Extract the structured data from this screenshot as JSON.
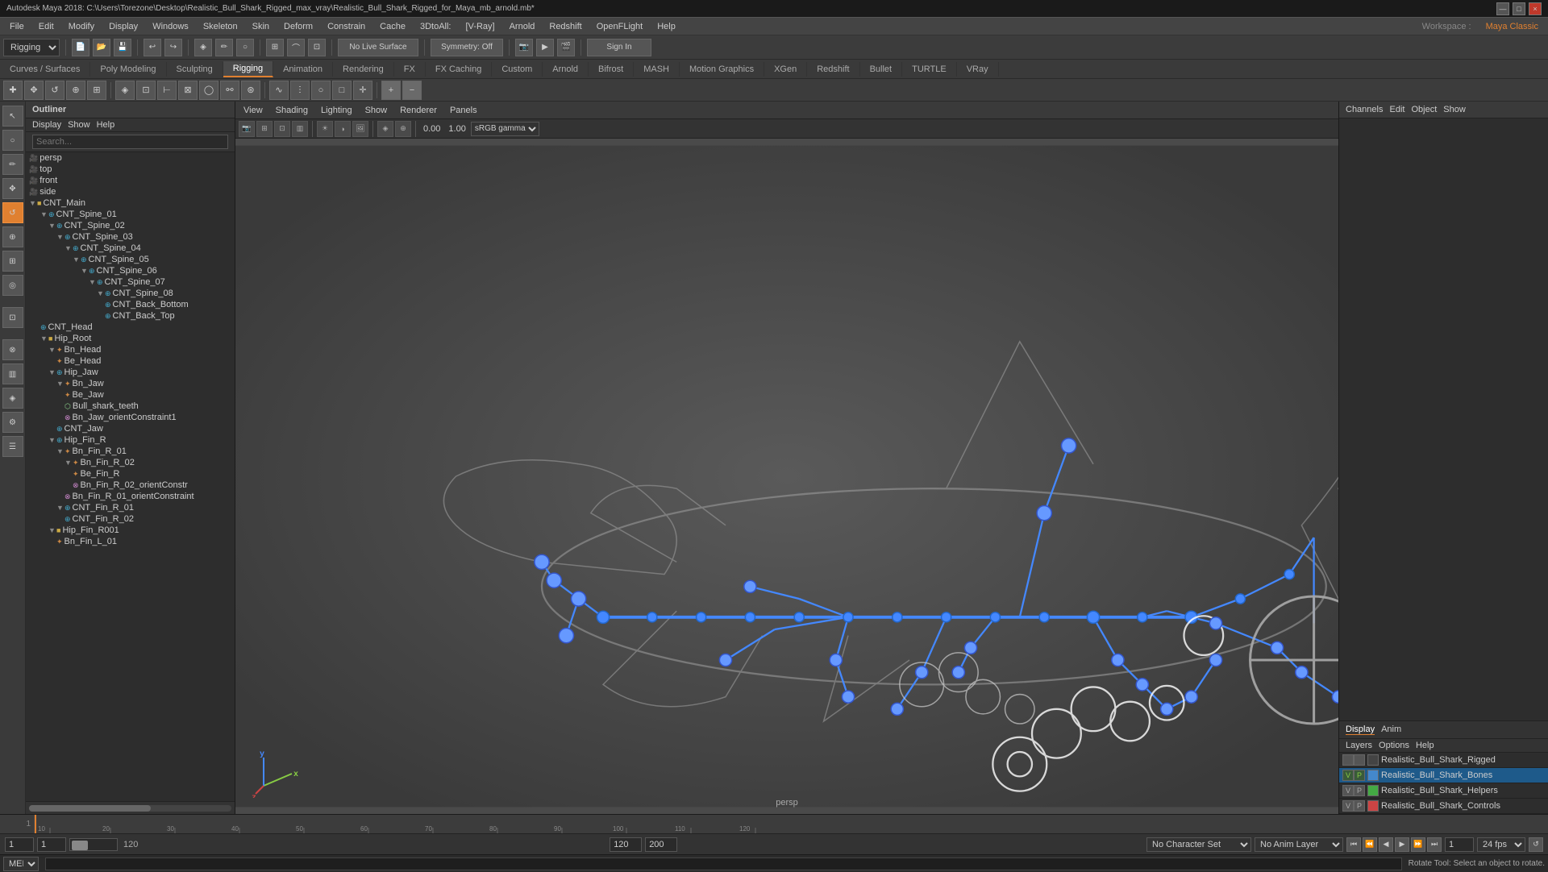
{
  "titlebar": {
    "text": "Autodesk Maya 2018: C:\\Users\\Torezone\\Desktop\\Realistic_Bull_Shark_Rigged_max_vray\\Realistic_Bull_Shark_Rigged_for_Maya_mb_arnold.mb*"
  },
  "menubar": {
    "items": [
      "File",
      "Edit",
      "Modify",
      "Display",
      "Windows",
      "Skeleton",
      "Skin",
      "Deform",
      "Constrain",
      "Cache",
      "3DtoAll:",
      "[V-Ray]",
      "Arnold",
      "Redshift",
      "OpenFLight",
      "Help"
    ]
  },
  "toolbar1": {
    "workspace_label": "Workspace :",
    "workspace_value": "Maya Classic",
    "rigging_label": "Rigging",
    "no_live_surface": "No Live Surface",
    "symmetry_label": "Symmetry: Off",
    "sign_in_label": "Sign In"
  },
  "tabs": {
    "items": [
      "Curves / Surfaces",
      "Poly Modeling",
      "Sculpting",
      "Rigging",
      "Animation",
      "Rendering",
      "FX",
      "FX Caching",
      "Custom",
      "Arnold",
      "Bifrost",
      "MASH",
      "Motion Graphics",
      "XGen",
      "Redshift",
      "Bullet",
      "TURTLE",
      "VRay"
    ]
  },
  "outliner": {
    "title": "Outliner",
    "menu": [
      "Display",
      "Show",
      "Help"
    ],
    "search_placeholder": "Search...",
    "tree": [
      {
        "label": "persp",
        "indent": 0,
        "icon": "cam"
      },
      {
        "label": "top",
        "indent": 0,
        "icon": "cam"
      },
      {
        "label": "front",
        "indent": 0,
        "icon": "cam"
      },
      {
        "label": "side",
        "indent": 0,
        "icon": "cam"
      },
      {
        "label": "CNT_Main",
        "indent": 0,
        "icon": "grp",
        "expanded": true
      },
      {
        "label": "CNT_Spine_01",
        "indent": 1,
        "icon": "ctrl"
      },
      {
        "label": "CNT_Spine_02",
        "indent": 2,
        "icon": "ctrl"
      },
      {
        "label": "CNT_Spine_03",
        "indent": 3,
        "icon": "ctrl"
      },
      {
        "label": "CNT_Spine_04",
        "indent": 4,
        "icon": "ctrl"
      },
      {
        "label": "CNT_Spine_05",
        "indent": 5,
        "icon": "ctrl"
      },
      {
        "label": "CNT_Spine_06",
        "indent": 6,
        "icon": "ctrl"
      },
      {
        "label": "CNT_Spine_07",
        "indent": 7,
        "icon": "ctrl"
      },
      {
        "label": "CNT_Spine_08",
        "indent": 8,
        "icon": "ctrl"
      },
      {
        "label": "CNT_Back_Bottom",
        "indent": 9,
        "icon": "ctrl"
      },
      {
        "label": "CNT_Back_Top",
        "indent": 9,
        "icon": "ctrl"
      },
      {
        "label": "CNT_Head",
        "indent": 1,
        "icon": "ctrl"
      },
      {
        "label": "Hip_Root",
        "indent": 1,
        "icon": "grp"
      },
      {
        "label": "Bn_Head",
        "indent": 2,
        "icon": "bone"
      },
      {
        "label": "Be_Head",
        "indent": 3,
        "icon": "bone"
      },
      {
        "label": "Hip_Jaw",
        "indent": 2,
        "icon": "ctrl"
      },
      {
        "label": "Bn_Jaw",
        "indent": 3,
        "icon": "bone"
      },
      {
        "label": "Be_Jaw",
        "indent": 4,
        "icon": "bone"
      },
      {
        "label": "Bull_shark_teeth",
        "indent": 4,
        "icon": "mesh"
      },
      {
        "label": "Bn_Jaw_orientConstraint1",
        "indent": 4,
        "icon": "cstr"
      },
      {
        "label": "CNT_Jaw",
        "indent": 3,
        "icon": "ctrl"
      },
      {
        "label": "Hip_Fin_R",
        "indent": 2,
        "icon": "ctrl"
      },
      {
        "label": "Bn_Fin_R_01",
        "indent": 3,
        "icon": "bone"
      },
      {
        "label": "Bn_Fin_R_02",
        "indent": 4,
        "icon": "bone"
      },
      {
        "label": "Be_Fin_R",
        "indent": 5,
        "icon": "bone"
      },
      {
        "label": "Bn_Fin_R_02_orientConstr",
        "indent": 5,
        "icon": "cstr"
      },
      {
        "label": "Bn_Fin_R_01_orientConstraint",
        "indent": 4,
        "icon": "cstr"
      },
      {
        "label": "CNT_Fin_R_01",
        "indent": 3,
        "icon": "ctrl"
      },
      {
        "label": "CNT_Fin_R_02",
        "indent": 4,
        "icon": "ctrl"
      },
      {
        "label": "Hip_Fin_R001",
        "indent": 2,
        "icon": "grp"
      },
      {
        "label": "Bn_Fin_L_01",
        "indent": 3,
        "icon": "bone"
      }
    ]
  },
  "viewport": {
    "menus": [
      "View",
      "Shading",
      "Lighting",
      "Show",
      "Renderer",
      "Panels"
    ],
    "label": "persp",
    "axis_label": "y\nz  x"
  },
  "channel_box": {
    "tabs": [
      "Channels",
      "Edit",
      "Object",
      "Show"
    ],
    "layers_tabs": [
      "Display",
      "Anim"
    ],
    "layers_menu": [
      "Layers",
      "Options",
      "Help"
    ],
    "layers": [
      {
        "name": "Realistic_Bull_Shark_Rigged",
        "v": "",
        "p": "",
        "color": "#444444"
      },
      {
        "name": "Realistic_Bull_Shark_Bones",
        "v": "V",
        "p": "P",
        "color": "#4488cc",
        "selected": true
      },
      {
        "name": "Realistic_Bull_Shark_Helpers",
        "v": "V",
        "p": "P",
        "color": "#44aa44"
      },
      {
        "name": "Realistic_Bull_Shark_Controls",
        "v": "V",
        "p": "P",
        "color": "#cc4444"
      }
    ]
  },
  "bottom_controls": {
    "frame_start": "1",
    "frame_current": "1",
    "frame_end_display": "120",
    "frame_end": "120",
    "frame_max": "200",
    "fps_label": "24 fps",
    "no_character_set": "No Character Set",
    "no_anim_layer": "No Anim Layer",
    "frame_indicator": "1"
  },
  "status_bar": {
    "language": "MEL",
    "message": "Rotate Tool: Select an object to rotate."
  },
  "icons": {
    "minimize": "—",
    "restore": "□",
    "close": "×",
    "arrow_right": "▶",
    "arrow_down": "▼",
    "play": "▶",
    "prev": "◀",
    "next": "▶",
    "first": "◀◀",
    "last": "▶▶"
  }
}
